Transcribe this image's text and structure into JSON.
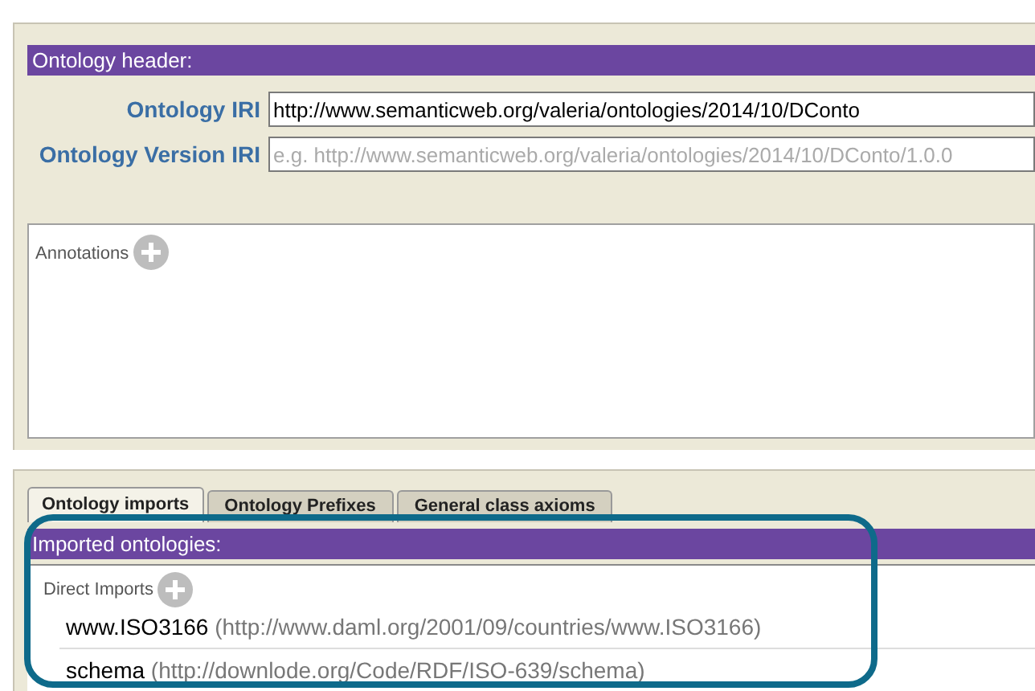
{
  "header": {
    "title": "Ontology header:",
    "fields": [
      {
        "label": "Ontology IRI",
        "value": "http://www.semanticweb.org/valeria/ontologies/2014/10/DConto"
      },
      {
        "label": "Ontology Version IRI",
        "placeholder": "e.g. http://www.semanticweb.org/valeria/ontologies/2014/10/DConto/1.0.0"
      }
    ],
    "annotations": {
      "label": "Annotations"
    }
  },
  "tabs": [
    {
      "label": "Ontology imports",
      "selected": true
    },
    {
      "label": "Ontology Prefixes",
      "selected": false
    },
    {
      "label": "General class axioms",
      "selected": false
    }
  ],
  "imports": {
    "title": "Imported ontologies:",
    "section": "Direct Imports",
    "items": [
      {
        "name": "www.ISO3166",
        "iri": "(http://www.daml.org/2001/09/countries/www.ISO3166)"
      },
      {
        "name": "schema",
        "iri": "(http://downlode.org/Code/RDF/ISO-639/schema)"
      }
    ]
  }
}
